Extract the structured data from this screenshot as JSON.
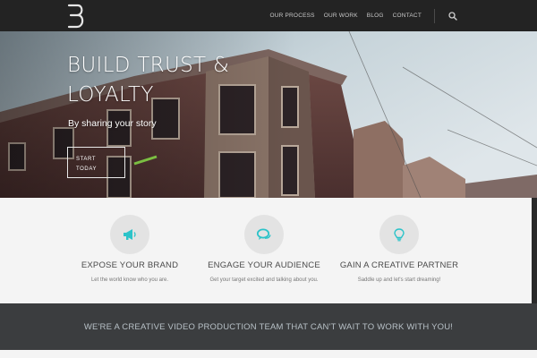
{
  "header": {
    "logo_icon": "b-monogram-logo",
    "nav": [
      {
        "label": "OUR PROCESS"
      },
      {
        "label": "OUR WORK"
      },
      {
        "label": "BLOG"
      },
      {
        "label": "CONTACT"
      }
    ],
    "search_icon": "search-icon"
  },
  "hero": {
    "title_line1": "BUILD TRUST &",
    "title_line2": "LOYALTY",
    "subtitle": "By sharing your story",
    "cta_line1": "START",
    "cta_line2": "TODAY"
  },
  "features": [
    {
      "icon": "megaphone-icon",
      "title": "EXPOSE YOUR BRAND",
      "desc": "Let the world know who you are."
    },
    {
      "icon": "chat-bubbles-icon",
      "title": "ENGAGE YOUR AUDIENCE",
      "desc": "Get your target excited and talking about you."
    },
    {
      "icon": "lightbulb-icon",
      "title": "GAIN A CREATIVE PARTNER",
      "desc": "Saddle up and let's start dreaming!"
    }
  ],
  "banner": {
    "text": "WE'RE A CREATIVE VIDEO PRODUCTION TEAM THAT CAN'T WAIT TO WORK WITH YOU!"
  },
  "colors": {
    "header_bg": "#232323",
    "accent": "#2cc3c9",
    "banner_bg": "#3b3d3f",
    "page_bg": "#f4f4f4"
  }
}
